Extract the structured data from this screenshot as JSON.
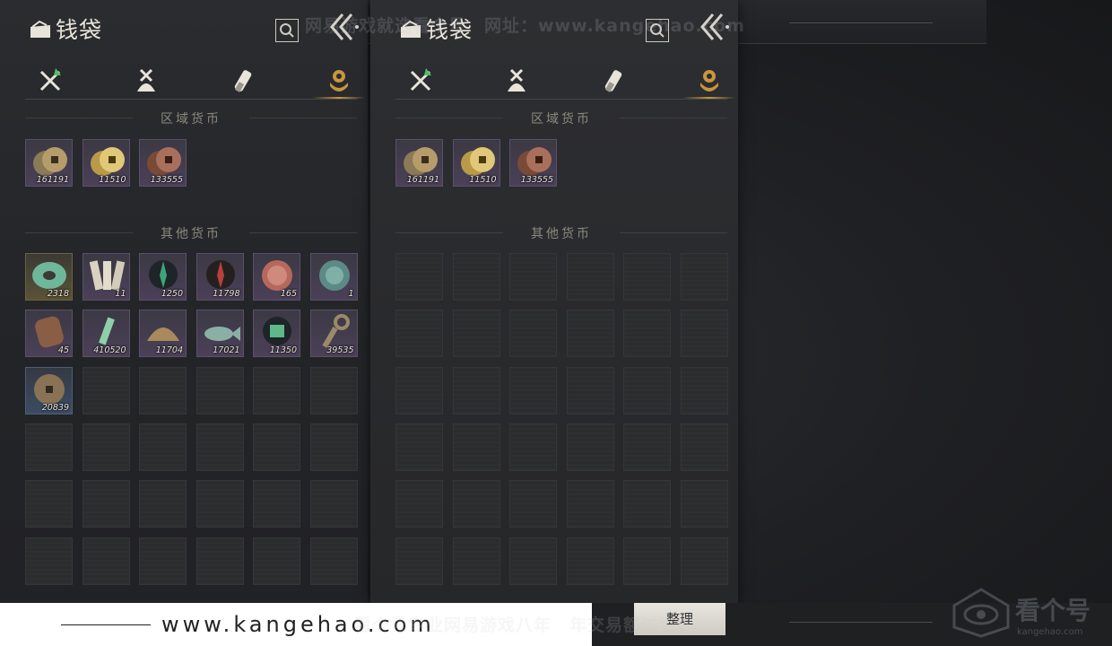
{
  "panels": [
    {
      "title": "钱袋",
      "section_regional": "区域货币",
      "section_other": "其他货币",
      "regional": [
        {
          "qty": "161191",
          "art": "coin-bronze"
        },
        {
          "qty": "11510",
          "art": "coin-gold"
        },
        {
          "qty": "133555",
          "art": "coin-copper"
        }
      ],
      "other": [
        {
          "qty": "2318",
          "art": "jade-ring",
          "rarity": "gold"
        },
        {
          "qty": "11",
          "art": "paper-notes",
          "rarity": "purple"
        },
        {
          "qty": "1250",
          "art": "green-feather",
          "rarity": "purple"
        },
        {
          "qty": "11798",
          "art": "red-feather",
          "rarity": "purple"
        },
        {
          "qty": "165",
          "art": "red-medal",
          "rarity": "purple"
        },
        {
          "qty": "1",
          "art": "jade-medal",
          "rarity": "purple"
        },
        {
          "qty": "45",
          "art": "bronze-plate",
          "rarity": "purple"
        },
        {
          "qty": "410520",
          "art": "jade-stick",
          "rarity": "purple"
        },
        {
          "qty": "11704",
          "art": "bronze-dome",
          "rarity": "purple"
        },
        {
          "qty": "17021",
          "art": "jade-fish",
          "rarity": "purple"
        },
        {
          "qty": "11350",
          "art": "jade-token",
          "rarity": "purple"
        },
        {
          "qty": "39535",
          "art": "bronze-key",
          "rarity": "purple"
        },
        {
          "qty": "20839",
          "art": "old-coin",
          "rarity": "blue"
        }
      ]
    },
    {
      "title": "钱袋",
      "section_regional": "区域货币",
      "section_other": "其他货币",
      "regional": [
        {
          "qty": "161191",
          "art": "coin-bronze"
        },
        {
          "qty": "11510",
          "art": "coin-gold"
        },
        {
          "qty": "133555",
          "art": "coin-copper"
        }
      ],
      "other": []
    }
  ],
  "tabs": [
    "weapons-icon",
    "pouch-icon",
    "scroll-icon",
    "currency-icon"
  ],
  "active_tab": 3,
  "sort_button": "整理",
  "banner_text": "www.kangehao.com",
  "watermark_top": "网易游戏就选看个号　网址：www.kangehao.com",
  "watermark_bottom": "看个号专业网易游戏八年　年交易额过百亿",
  "logo_text": "看个号",
  "logo_sub": "kangehao.com",
  "colors": {
    "accent": "#c8963c",
    "purple_slot": "#4b4058",
    "gold_slot": "#5b5236",
    "blue_slot": "#3c4c63"
  }
}
